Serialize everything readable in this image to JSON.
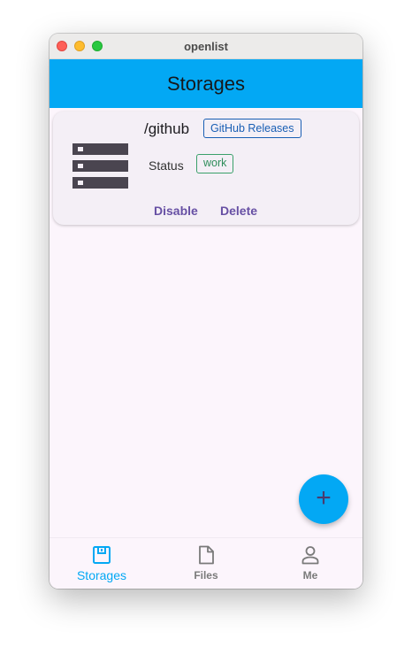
{
  "window": {
    "title": "openlist"
  },
  "appbar": {
    "title": "Storages"
  },
  "storages": [
    {
      "icon": "storage-icon",
      "mount_path": "/github",
      "driver": "GitHub Releases",
      "status_label": "Status",
      "status": "work",
      "actions": {
        "disable": "Disable",
        "delete": "Delete"
      }
    }
  ],
  "fab": {
    "icon": "add-icon",
    "symbol": "+"
  },
  "bottom_nav": {
    "items": [
      {
        "label": "Storages",
        "icon": "storage-nav-icon",
        "active": true
      },
      {
        "label": "Files",
        "icon": "file-icon",
        "active": false
      },
      {
        "label": "Me",
        "icon": "person-icon",
        "active": false
      }
    ]
  },
  "colors": {
    "accent": "#03a8f4",
    "action": "#6750a4",
    "chip_driver": "#1a5fb4",
    "chip_status": "#2e8d5a"
  }
}
